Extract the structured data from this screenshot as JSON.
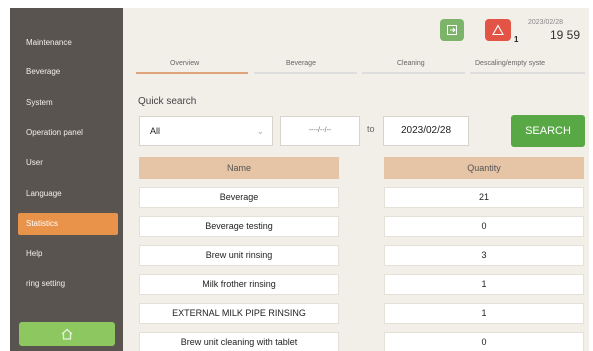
{
  "sidebar": {
    "items": [
      {
        "label": "Maintenance",
        "active": false
      },
      {
        "label": "Beverage",
        "active": false
      },
      {
        "label": "System",
        "active": false
      },
      {
        "label": "Operation panel",
        "active": false
      },
      {
        "label": "User",
        "active": false
      },
      {
        "label": "Language",
        "active": false
      },
      {
        "label": "Statistics",
        "active": true
      },
      {
        "label": "Help",
        "active": false
      },
      {
        "label": "ring setting",
        "active": false
      }
    ],
    "home_icon": "home-icon"
  },
  "status": {
    "alarm_count": "1",
    "date": "2023/02/28",
    "time": "19 59"
  },
  "tabs": [
    "Overview",
    "Beverage",
    "Cleaning",
    "Descaling/empty syste"
  ],
  "active_tab": "Overview",
  "quick_search": {
    "label": "Quick search",
    "filter_value": "All",
    "date_from": "----/--/--",
    "to_label": "to",
    "date_to": "2023/02/28",
    "search_label": "SEARCH"
  },
  "table": {
    "columns": [
      "Name",
      "Quantity"
    ],
    "rows": [
      {
        "name": "Beverage",
        "quantity": "21"
      },
      {
        "name": "Beverage testing",
        "quantity": "0"
      },
      {
        "name": "Brew unit rinsing",
        "quantity": "3"
      },
      {
        "name": "Milk frother rinsing",
        "quantity": "1"
      },
      {
        "name": "EXTERNAL MILK PIPE RINSING",
        "quantity": "1"
      },
      {
        "name": "Brew unit cleaning with tablet",
        "quantity": "0"
      }
    ]
  },
  "colors": {
    "sidebar_bg": "#5a5450",
    "active_item": "#e8924a",
    "search_button": "#58a845",
    "header_row": "#e6c4a6",
    "alarm_red": "#e25445",
    "exit_green": "#7cb56a"
  }
}
